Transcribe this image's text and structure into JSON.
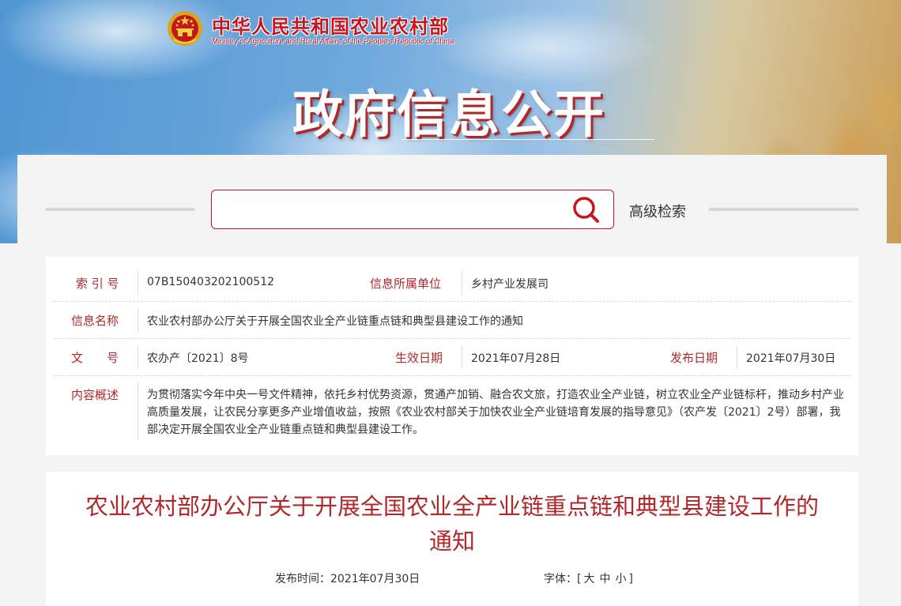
{
  "header": {
    "ministry_cn": "中华人民共和国农业农村部",
    "ministry_en": "Ministry of Agriculture and Rural Affairs of the People's Republic of China",
    "section_title": "政府信息公开"
  },
  "search": {
    "placeholder": "",
    "advanced_label": "高级检索"
  },
  "meta": {
    "index_label": "索 引 号",
    "index_value": "07B150403202100512",
    "unit_label": "信息所属单位",
    "unit_value": "乡村产业发展司",
    "name_label": "信息名称",
    "name_value": "农业农村部办公厅关于开展全国农业全产业链重点链和典型县建设工作的通知",
    "doc_no_label": "文　　号",
    "doc_no_value": "农办产〔2021〕8号",
    "effective_label": "生效日期",
    "effective_value": "2021年07月28日",
    "publish_label": "发布日期",
    "publish_value": "2021年07月30日",
    "summary_label": "内容概述",
    "summary_value": "为贯彻落实今年中央一号文件精神，依托乡村优势资源，贯通产加销、融合农文旅，打造农业全产业链，树立农业全产业链标杆，推动乡村产业高质量发展，让农民分享更多产业增值收益，按照《农业农村部关于加快农业全产业链培育发展的指导意见》（农产发〔2021〕2号）部署，我部决定开展全国农业全产业链重点链和典型县建设工作。"
  },
  "article": {
    "title": "农业农村部办公厅关于开展全国农业全产业链重点链和典型县建设工作的通知",
    "publish_time_label": "发布时间：",
    "publish_time_value": "2021年07月30日",
    "font_label": "字体：",
    "font_open": "[",
    "font_large": "大",
    "font_medium": "中",
    "font_small": "小",
    "font_close": "]"
  },
  "colors": {
    "accent": "#c4161c",
    "label_red": "#b1282b"
  }
}
